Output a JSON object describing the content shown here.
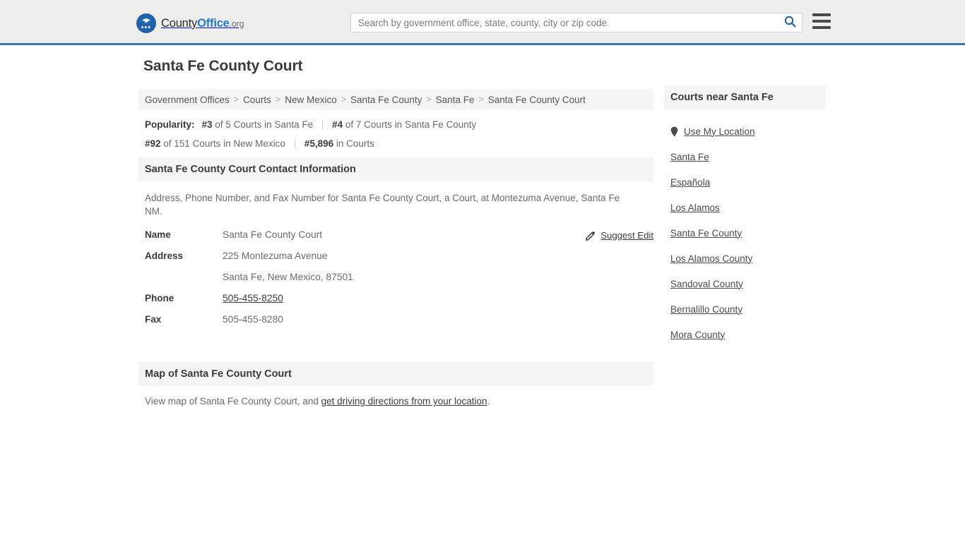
{
  "header": {
    "logo": {
      "icon": "county-office-eagle-logo",
      "part1": "County",
      "part2": "Office",
      "part3": ".org"
    },
    "search": {
      "placeholder": "Search by government office, state, county, city or zip code",
      "value": "",
      "button_icon": "search-icon"
    },
    "menu_icon": "hamburger-menu-icon",
    "accent_color": "#3a74a8"
  },
  "page_title": "Santa Fe County Court",
  "breadcrumb": {
    "separator": ">",
    "items": [
      "Government Offices",
      "Courts",
      "New Mexico",
      "Santa Fe County",
      "Santa Fe",
      "Santa Fe County Court"
    ]
  },
  "popularity": {
    "label": "Popularity:",
    "rows": [
      [
        {
          "rank": "#3",
          "text": " of 5 Courts in Santa Fe"
        },
        {
          "rank": "#4",
          "text": " of 7 Courts in Santa Fe County"
        }
      ],
      [
        {
          "rank": "#92",
          "text": " of 151 Courts in New Mexico"
        },
        {
          "rank": "#5,896",
          "text": " in Courts"
        }
      ]
    ]
  },
  "contact": {
    "heading": "Santa Fe County Court Contact Information",
    "description": "Address, Phone Number, and Fax Number for Santa Fe County Court, a Court, at Montezuma Avenue, Santa Fe NM.",
    "suggest_edit": {
      "icon": "edit-pencil-icon",
      "label": "Suggest Edit"
    },
    "rows": [
      {
        "label": "Name",
        "value": "Santa Fe County Court",
        "link": false
      },
      {
        "label": "Address",
        "value": "225 Montezuma Avenue",
        "link": false
      },
      {
        "label": "",
        "value": "Santa Fe, New Mexico, 87501",
        "link": false
      },
      {
        "label": "Phone",
        "value": "505-455-8250",
        "link": true
      },
      {
        "label": "Fax",
        "value": "505-455-8280",
        "link": false
      }
    ]
  },
  "map": {
    "heading": "Map of Santa Fe County Court",
    "desc_prefix": "View map of Santa Fe County Court, and ",
    "link_text": "get driving directions from your location",
    "desc_suffix": "."
  },
  "sidebar": {
    "heading": "Courts near Santa Fe",
    "use_my_location": {
      "icon": "map-pin-icon",
      "label": "Use My Location"
    },
    "links": [
      "Santa Fe",
      "Española",
      "Los Alamos",
      "Santa Fe County",
      "Los Alamos County",
      "Sandoval County",
      "Bernalillo County",
      "Mora County"
    ]
  }
}
